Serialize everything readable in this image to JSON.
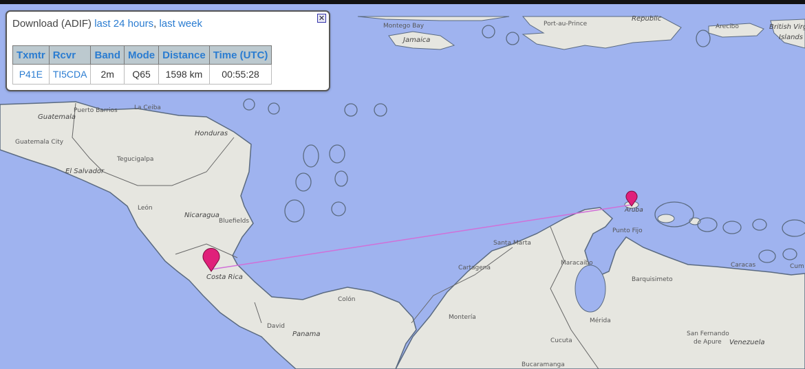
{
  "popup": {
    "download_label": "Download (ADIF)",
    "link_24h": "last 24 hours",
    "separator": ",",
    "link_week": "last week",
    "close_glyph": "✕",
    "columns": [
      "Txmtr",
      "Rcvr",
      "Band",
      "Mode",
      "Distance",
      "Time (UTC)"
    ],
    "row": {
      "txmtr": "P41E",
      "rcvr": "TI5CDA",
      "band": "2m",
      "mode": "Q65",
      "distance": "1598 km",
      "time": "00:55:28"
    }
  },
  "map": {
    "colors": {
      "ocean": "#9fb3ef",
      "land": "#e6e6e0",
      "border": "#555555",
      "marker": "#e0207a",
      "path": "#d070d8"
    },
    "labels": {
      "montego_bay": "Montego Bay",
      "jamaica": "Jamaica",
      "port_au_prince": "Port-au-Prince",
      "republic": "Republic",
      "arecibo": "Arecibo",
      "british_virgin": "British Virg",
      "islands": "Islands",
      "puerto_barrios": "Puerto Barrios",
      "la_ceiba": "La Ceiba",
      "guatemala": "Guatemala",
      "honduras": "Honduras",
      "guatemala_city": "Guatemala City",
      "tegucigalpa": "Tegucigalpa",
      "el_salvador": "El Salvador",
      "leon": "León",
      "nicaragua": "Nicaragua",
      "bluefields": "Bluefields",
      "costa_rica": "Costa Rica",
      "colon": "Colón",
      "david": "David",
      "panama": "Panama",
      "santa_marta": "Santa Marta",
      "cartagena": "Cartagena",
      "maracaibo": "Maracaibo",
      "barquisimeto": "Barquisimeto",
      "caracas": "Caracas",
      "cum": "Cum",
      "punto_fijo": "Punto Fijo",
      "aruba": "Aruba",
      "monteria": "Montería",
      "merida": "Mérida",
      "cucuta": "Cucuta",
      "san_fernando": "San Fernando",
      "de_apure": "de Apure",
      "venezuela": "Venezuela",
      "bucaramanga": "Bucaramanga"
    }
  }
}
